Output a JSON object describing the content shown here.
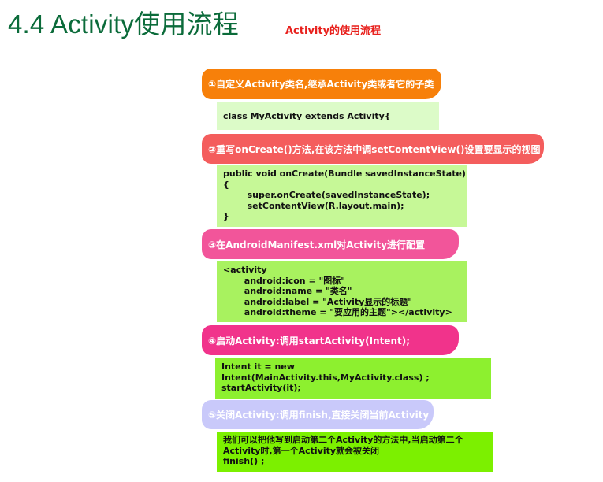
{
  "title": "4.4 Activity使用流程",
  "subtitle": "Activity的使用流程",
  "steps": [
    {
      "label": "①自定义Activity类名,继承Activity类或者它的子类"
    },
    {
      "label": "②重写onCreate()方法,在该方法中调setContentView()设置要显示的视图"
    },
    {
      "label": "③在AndroidManifest.xml对Activity进行配置"
    },
    {
      "label": "④启动Activity:调用startActivity(Intent);"
    },
    {
      "label": "⑤关闭Activity:调用finish,直接关闭当前Activity"
    }
  ],
  "code_blocks": [
    {
      "text": "class MyActivity extends Activity{"
    },
    {
      "text": "public void onCreate(Bundle savedInstanceState)\n{\n        super.onCreate(savedInstanceState);\n        setContentView(R.layout.main);\n}"
    },
    {
      "text": "<activity\n       android:icon = \"图标\"\n       android:name = \"类名\"\n       android:label = \"Activity显示的标题\"\n       android:theme = \"要应用的主题\"></activity>"
    },
    {
      "text": "Intent it = new\nIntent(MainActivity.this,MyActivity.class) ;\nstartActivity(it);"
    },
    {
      "text": "我们可以把他写到启动第二个Activity的方法中,当启动第二个\nActivity时,第一个Activity就会被关闭\nfinish() ;"
    }
  ]
}
